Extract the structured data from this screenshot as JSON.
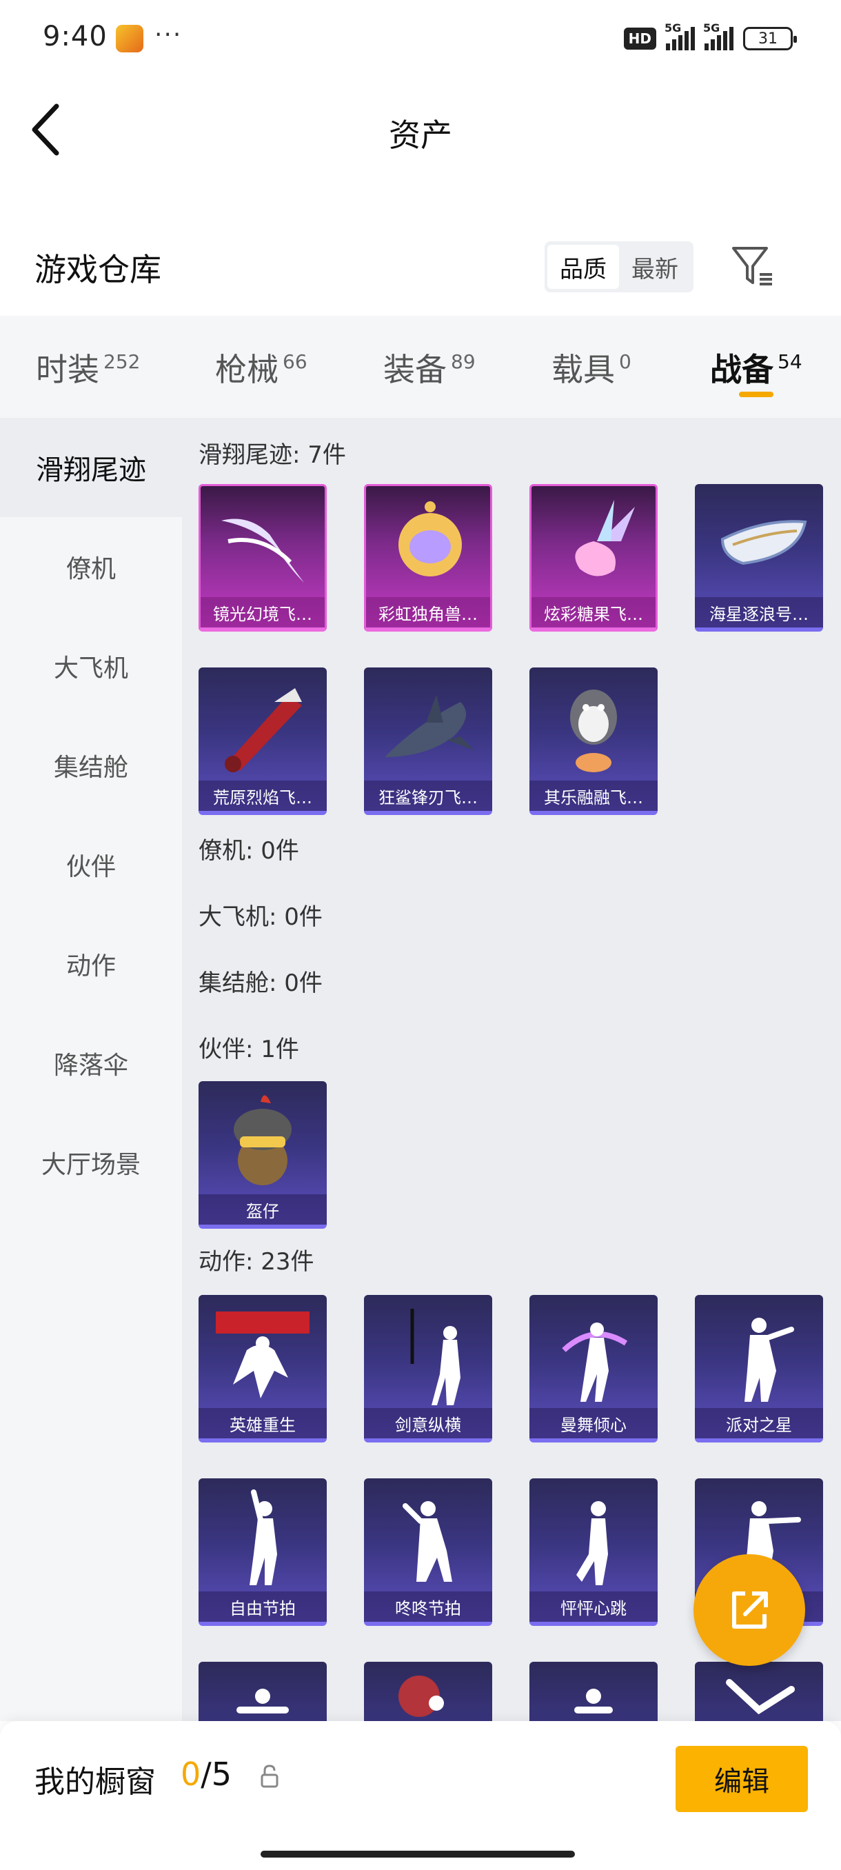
{
  "status": {
    "time": "9:40",
    "dots": "···",
    "hd": "HD",
    "net1": "5G",
    "net2": "5G",
    "battery": "31"
  },
  "header": {
    "title": "资产"
  },
  "warehouse": {
    "title": "游戏仓库",
    "sort": [
      "品质",
      "最新"
    ],
    "sort_active": 0
  },
  "tabs": [
    {
      "label": "时装",
      "count": "252"
    },
    {
      "label": "枪械",
      "count": "66"
    },
    {
      "label": "装备",
      "count": "89"
    },
    {
      "label": "载具",
      "count": "0"
    },
    {
      "label": "战备",
      "count": "54"
    }
  ],
  "active_tab": 4,
  "side": [
    "滑翔尾迹",
    "僚机",
    "大飞机",
    "集结舱",
    "伙伴",
    "动作",
    "降落伞",
    "大厅场景"
  ],
  "sections": {
    "glide": {
      "title": "滑翔尾迹: 7件",
      "items": [
        "镜光幻境飞…",
        "彩虹独角兽…",
        "炫彩糖果飞…",
        "海星逐浪号…",
        "荒原烈焰飞…",
        "狂鲨锋刃飞…",
        "其乐融融飞…"
      ]
    },
    "wingman": {
      "title": "僚机: 0件"
    },
    "plane": {
      "title": "大飞机: 0件"
    },
    "pod": {
      "title": "集结舱: 0件"
    },
    "partner": {
      "title": "伙伴: 1件",
      "items": [
        "盔仔"
      ]
    },
    "emote": {
      "title": "动作: 23件",
      "items": [
        "英雄重生",
        "剑意纵横",
        "曼舞倾心",
        "派对之星",
        "自由节拍",
        "咚咚节拍",
        "怦怦心跳",
        ""
      ]
    }
  },
  "bottom": {
    "showcase_label": "我的橱窗",
    "count_current": "0",
    "count_rest": "/5",
    "edit_label": "编辑"
  },
  "colors": {
    "accent": "#f5a800",
    "card_purple": "#3a3580",
    "card_pink": "#c53bc4"
  }
}
